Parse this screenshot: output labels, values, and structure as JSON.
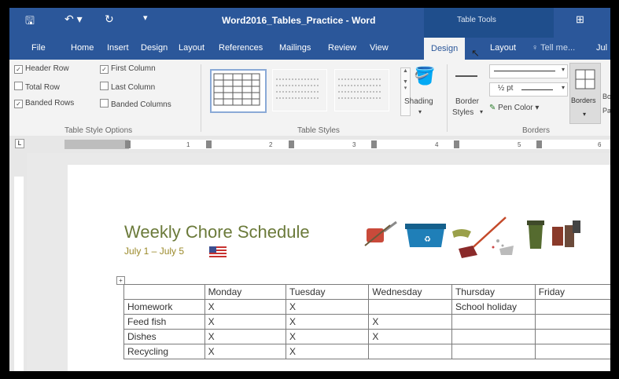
{
  "titlebar": {
    "doc_title": "Word2016_Tables_Practice - Word",
    "context_group": "Table Tools"
  },
  "tabs": [
    "File",
    "Home",
    "Insert",
    "Design",
    "Layout",
    "References",
    "Mailings",
    "Review",
    "View",
    "Design",
    "Layout"
  ],
  "tell_me": "Tell me...",
  "user_partial": "Jul",
  "ribbon": {
    "style_options": {
      "header_row": "Header Row",
      "total_row": "Total Row",
      "banded_rows": "Banded Rows",
      "first_column": "First Column",
      "last_column": "Last Column",
      "banded_columns": "Banded Columns",
      "label": "Table Style Options"
    },
    "table_styles_label": "Table Styles",
    "shading_label": "Shading",
    "border_styles_label": "Border Styles",
    "border_styles_l1": "Border",
    "border_styles_l2": "Styles",
    "pen_weight": "½ pt",
    "pen_color": "Pen Color",
    "borders_label": "Borders",
    "borders_btn": "Borders",
    "border_painter_partial_1": "Bo",
    "border_painter_partial_2": "Pa"
  },
  "ruler": {
    "numbers": [
      "1",
      "2",
      "3",
      "4",
      "5",
      "6"
    ]
  },
  "document": {
    "title": "Weekly Chore Schedule",
    "subtitle": "July 1 – July 5",
    "table": {
      "headers": [
        "",
        "Monday",
        "Tuesday",
        "Wednesday",
        "Thursday",
        "Friday"
      ],
      "rows": [
        [
          "Homework",
          "X",
          "X",
          "",
          "School holiday",
          ""
        ],
        [
          "Feed fish",
          "X",
          "X",
          "X",
          "",
          ""
        ],
        [
          "Dishes",
          "X",
          "X",
          "X",
          "",
          ""
        ],
        [
          "Recycling",
          "X",
          "X",
          "",
          "",
          ""
        ]
      ]
    }
  },
  "colors": {
    "ribbon_blue": "#2b579a",
    "context_blue": "#1f4e8c",
    "title_green": "#6b7a3a"
  }
}
